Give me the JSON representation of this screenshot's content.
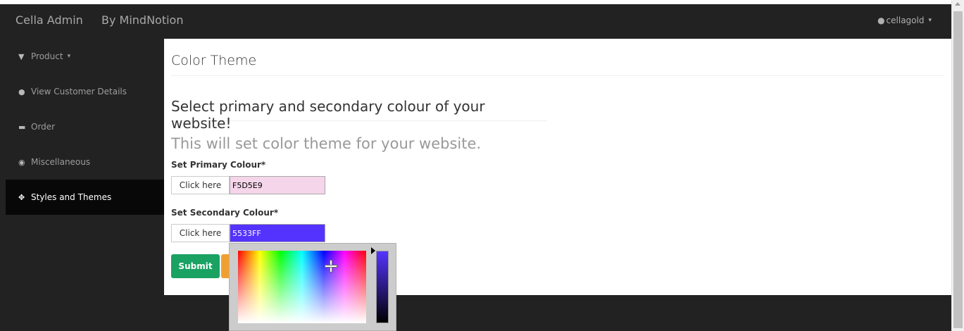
{
  "navbar": {
    "brand": "Cella Admin",
    "subtitle": "By MindNotion",
    "user_label": "cellagold",
    "user_icon": "user-icon",
    "caret": "▾"
  },
  "sidebar": {
    "items": [
      {
        "label": "Product",
        "icon": "filter-icon",
        "glyph": "▼"
      },
      {
        "label": "View Customer Details",
        "icon": "user-icon",
        "glyph": "●"
      },
      {
        "label": "Order",
        "icon": "cart-icon",
        "glyph": "▬"
      },
      {
        "label": "Miscellaneous",
        "icon": "dashboard-icon",
        "glyph": "◉"
      },
      {
        "label": "Styles and Themes",
        "icon": "crosshair-icon",
        "glyph": "✥"
      }
    ],
    "dropdown_caret": "▾"
  },
  "main": {
    "page_title": "Color Theme",
    "heading": "Select primary and secondary colour of your website!",
    "notice": "This will set color theme for your website.",
    "primary": {
      "label": "Set Primary Colour*",
      "button": "Click here",
      "value": "F5D5E9",
      "color": "#F5D5E9",
      "text_color": "#000000"
    },
    "secondary": {
      "label": "Set Secondary Colour*",
      "button": "Click here",
      "value": "5533FF",
      "color": "#5533FF",
      "text_color": "#FFFFFF"
    },
    "submit": "Submit",
    "submit_color": "#1aa263",
    "reset_color": "#f0a030"
  }
}
